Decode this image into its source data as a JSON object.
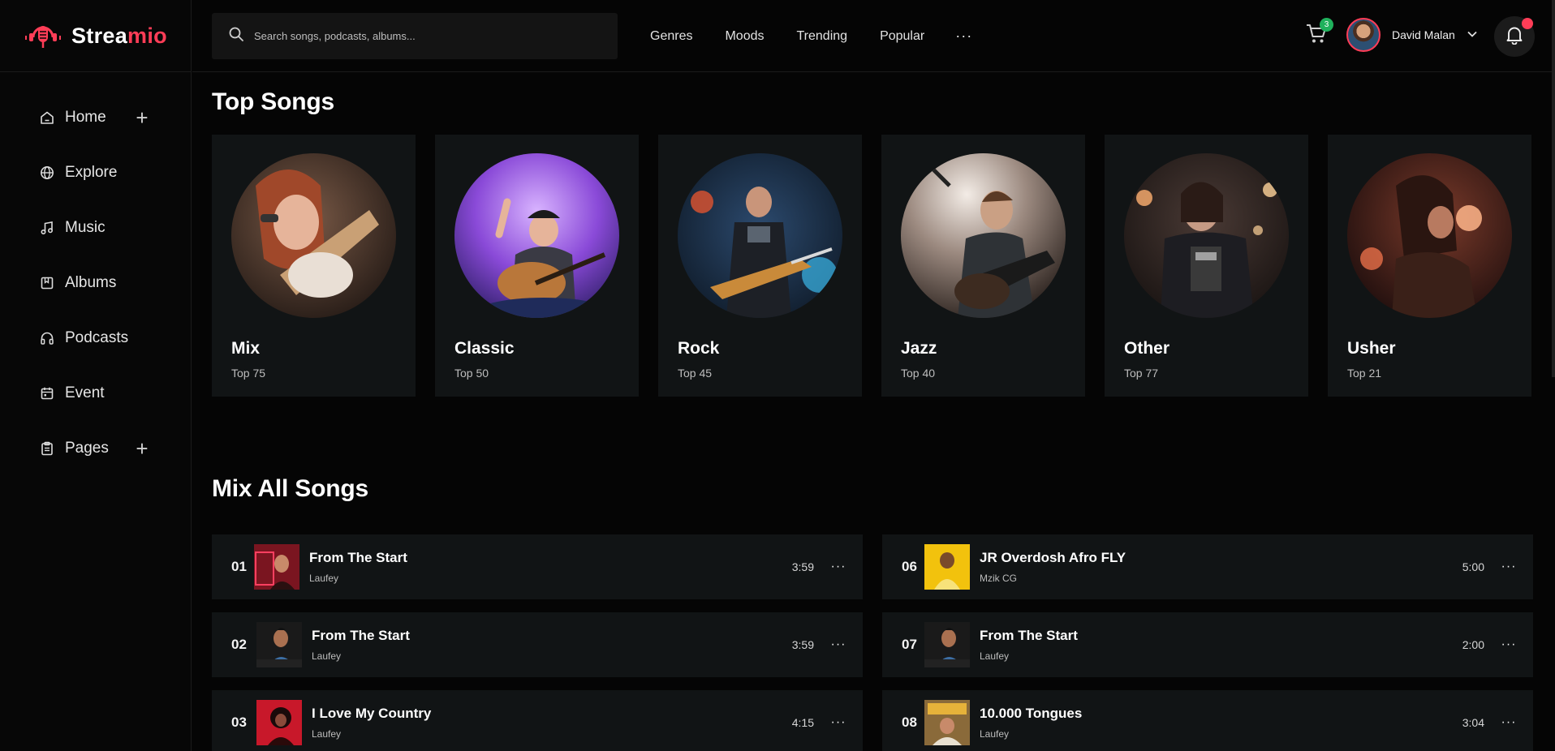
{
  "app": {
    "logo_a": "Strea",
    "logo_b": "mio",
    "brand_color": "#ff3d57"
  },
  "sidebar": {
    "items": [
      {
        "label": "Home",
        "icon": "home-icon",
        "expandable": true
      },
      {
        "label": "Explore",
        "icon": "globe-icon",
        "expandable": false
      },
      {
        "label": "Music",
        "icon": "music-note-icon",
        "expandable": false
      },
      {
        "label": "Albums",
        "icon": "album-icon",
        "expandable": false
      },
      {
        "label": "Podcasts",
        "icon": "headphones-icon",
        "expandable": false
      },
      {
        "label": "Event",
        "icon": "calendar-icon",
        "expandable": false
      },
      {
        "label": "Pages",
        "icon": "clipboard-icon",
        "expandable": true
      }
    ],
    "plus": "+"
  },
  "topbar": {
    "search_placeholder": "Search songs, podcasts, albums...",
    "nav": [
      "Genres",
      "Moods",
      "Trending",
      "Popular"
    ],
    "more": "···",
    "cart_count": "3",
    "user_name": "David Malan"
  },
  "top_songs": {
    "title": "Top Songs",
    "cards": [
      {
        "name": "Mix",
        "sub": "Top 75"
      },
      {
        "name": "Classic",
        "sub": "Top 50"
      },
      {
        "name": "Rock",
        "sub": "Top 45"
      },
      {
        "name": "Jazz",
        "sub": "Top 40"
      },
      {
        "name": "Other",
        "sub": "Top 77"
      },
      {
        "name": "Usher",
        "sub": "Top 21"
      }
    ]
  },
  "mix_all": {
    "title": "Mix All Songs",
    "songs": [
      {
        "num": "01",
        "title": "From The Start",
        "artist": "Laufey",
        "time": "3:59"
      },
      {
        "num": "02",
        "title": "From The Start",
        "artist": "Laufey",
        "time": "3:59"
      },
      {
        "num": "03",
        "title": "I Love My Country",
        "artist": "Laufey",
        "time": "4:15"
      },
      {
        "num": "06",
        "title": "JR Overdosh Afro FLY",
        "artist": "Mzik CG",
        "time": "5:00"
      },
      {
        "num": "07",
        "title": "From The Start",
        "artist": "Laufey",
        "time": "2:00"
      },
      {
        "num": "08",
        "title": "10.000 Tongues",
        "artist": "Laufey",
        "time": "3:04"
      }
    ],
    "more": "···"
  }
}
